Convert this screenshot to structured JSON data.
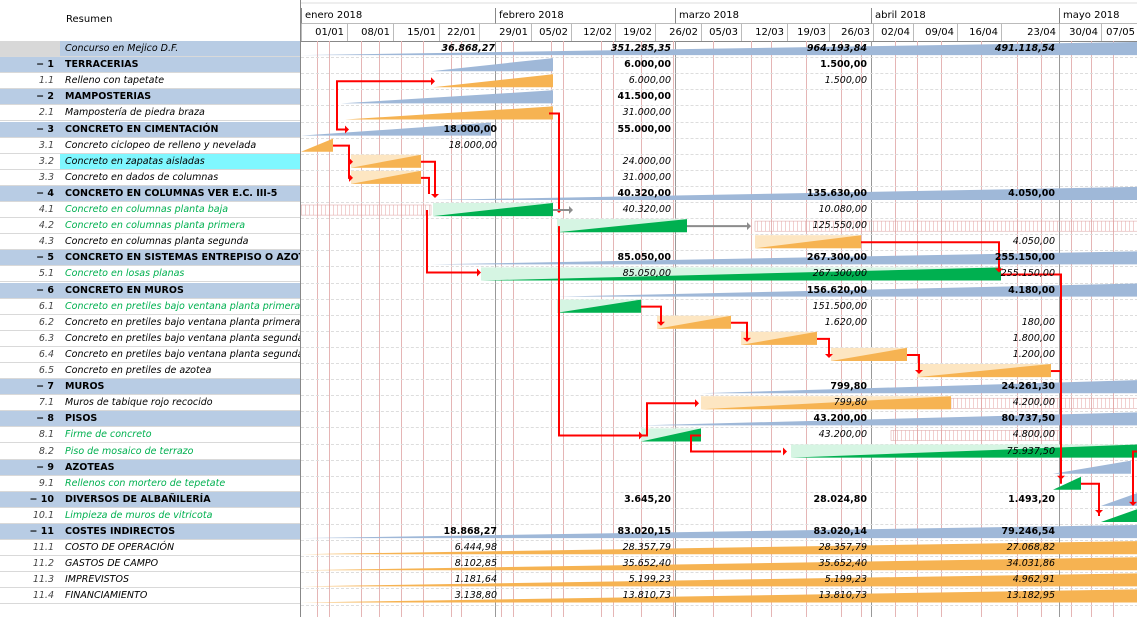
{
  "colors": {
    "summary_bar": "#9fb8d8",
    "task_bar": "#f6b352",
    "task_bar_light": "#fde6c2",
    "green_bar": "#00b050",
    "green_light": "#d6f5e3",
    "link": "#ff0000",
    "gray_link": "#8c8c8c",
    "hatch": "#e6a2a2"
  },
  "header": {
    "column_title": "Resumen"
  },
  "timeline": {
    "months": [
      "enero 2018",
      "febrero 2018",
      "marzo 2018",
      "abril 2018",
      "mayo 2018"
    ],
    "weeks": [
      "01/01",
      "08/01",
      "15/01",
      "22/01",
      "29/01",
      "05/02",
      "12/02",
      "19/02",
      "26/02",
      "05/03",
      "12/03",
      "19/03",
      "26/03",
      "02/04",
      "09/04",
      "16/04",
      "23/04",
      "30/04",
      "07/05"
    ]
  },
  "rows": [
    {
      "num": "",
      "name": "Concurso en Mejico D.F.",
      "kind": "top",
      "labels": [
        "36.868,27",
        "351.285,35",
        "964.193,84",
        "491.118,54"
      ]
    },
    {
      "num": "− 1",
      "name": "TERRACERIAS",
      "kind": "summary",
      "labels": [
        "6.000,00",
        "1.500,00"
      ]
    },
    {
      "num": "1.1",
      "name": "Relleno con tapetate",
      "kind": "task",
      "labels": [
        "6.000,00",
        "1.500,00"
      ]
    },
    {
      "num": "− 2",
      "name": "MAMPOSTERIAS",
      "kind": "summary",
      "labels": [
        "41.500,00"
      ]
    },
    {
      "num": "2.1",
      "name": "Mampostería de piedra braza",
      "kind": "task",
      "labels": [
        "31.000,00"
      ]
    },
    {
      "num": "− 3",
      "name": "CONCRETO EN CIMENTACIÓN",
      "kind": "summary",
      "labels": [
        "18.000,00",
        "55.000,00"
      ]
    },
    {
      "num": "3.1",
      "name": "Concreto ciclopeo de relleno y nevelada",
      "kind": "task",
      "labels": [
        "18.000,00"
      ]
    },
    {
      "num": "3.2",
      "name": "Concreto en zapatas aisladas",
      "kind": "task sel",
      "labels": [
        "24.000,00"
      ]
    },
    {
      "num": "3.3",
      "name": "Concreto en dados de columnas",
      "kind": "task",
      "labels": [
        "31.000,00"
      ]
    },
    {
      "num": "− 4",
      "name": "CONCRETO EN COLUMNAS VER E.C. III-5",
      "kind": "summary",
      "labels": [
        "40.320,00",
        "135.630,00",
        "4.050,00"
      ]
    },
    {
      "num": "4.1",
      "name": "Concreto en columnas planta baja",
      "kind": "task green",
      "labels": [
        "40.320,00",
        "10.080,00"
      ]
    },
    {
      "num": "4.2",
      "name": "Concreto en columnas planta primera",
      "kind": "task green",
      "labels": [
        "125.550,00"
      ]
    },
    {
      "num": "4.3",
      "name": "Concreto en columnas planta segunda",
      "kind": "task",
      "labels": [
        "4.050,00"
      ]
    },
    {
      "num": "− 5",
      "name": "CONCRETO EN SISTEMAS ENTREPISO O AZOTE",
      "kind": "summary",
      "labels": [
        "85.050,00",
        "267.300,00",
        "255.150,00"
      ]
    },
    {
      "num": "5.1",
      "name": "Concreto en losas planas",
      "kind": "task green",
      "labels": [
        "85.050,00",
        "267.300,00",
        "255.150,00"
      ]
    },
    {
      "num": "− 6",
      "name": "CONCRETO EN MUROS",
      "kind": "summary",
      "labels": [
        "156.620,00",
        "4.180,00"
      ]
    },
    {
      "num": "6.1",
      "name": "Concreto en pretiles bajo ventana planta primera",
      "kind": "task green",
      "labels": [
        "151.500,00"
      ]
    },
    {
      "num": "6.2",
      "name": "Concreto en pretiles bajo ventana planta primera",
      "kind": "task",
      "labels": [
        "1.620,00",
        "180,00"
      ]
    },
    {
      "num": "6.3",
      "name": "Concreto en pretiles bajo ventana planta segunda",
      "kind": "task",
      "labels": [
        "1.800,00"
      ]
    },
    {
      "num": "6.4",
      "name": "Concreto en pretiles bajo ventana planta segunda",
      "kind": "task",
      "labels": [
        "1.200,00"
      ]
    },
    {
      "num": "6.5",
      "name": "Concreto en pretiles de azotea",
      "kind": "task",
      "labels": []
    },
    {
      "num": "− 7",
      "name": "MUROS",
      "kind": "summary",
      "labels": [
        "799,80",
        "24.261,30"
      ]
    },
    {
      "num": "7.1",
      "name": "Muros de tabique rojo recocido",
      "kind": "task",
      "labels": [
        "799,80",
        "4.200,00"
      ]
    },
    {
      "num": "− 8",
      "name": "PISOS",
      "kind": "summary",
      "labels": [
        "43.200,00",
        "80.737,50"
      ]
    },
    {
      "num": "8.1",
      "name": "Firme de concreto",
      "kind": "task green",
      "labels": [
        "43.200,00",
        "4.800,00"
      ]
    },
    {
      "num": "8.2",
      "name": "Piso de mosaico de terrazo",
      "kind": "task green",
      "labels": [
        "75.937,50"
      ]
    },
    {
      "num": "− 9",
      "name": "AZOTEAS",
      "kind": "summary",
      "labels": []
    },
    {
      "num": "9.1",
      "name": "Rellenos con mortero de tepetate",
      "kind": "task green",
      "labels": []
    },
    {
      "num": "− 10",
      "name": "DIVERSOS DE ALBAÑILERÍA",
      "kind": "summary",
      "labels": [
        "3.645,20",
        "28.024,80",
        "1.493,20"
      ]
    },
    {
      "num": "10.1",
      "name": "Limpieza de muros de vitricota",
      "kind": "task green",
      "labels": []
    },
    {
      "num": "− 11",
      "name": "COSTES INDIRECTOS",
      "kind": "summary",
      "labels": [
        "18.868,27",
        "83.020,15",
        "83.020,14",
        "79.246,54"
      ]
    },
    {
      "num": "11.1",
      "name": "COSTO DE OPERACIÓN",
      "kind": "task",
      "labels": [
        "6.444,98",
        "28.357,79",
        "28.357,79",
        "27.068,82"
      ]
    },
    {
      "num": "11.2",
      "name": "GASTOS DE CAMPO",
      "kind": "task",
      "labels": [
        "8.102,85",
        "35.652,40",
        "35.652,40",
        "34.031,86"
      ]
    },
    {
      "num": "11.3",
      "name": "IMPREVISTOS",
      "kind": "task",
      "labels": [
        "1.181,64",
        "5.199,23",
        "5.199,23",
        "4.962,91"
      ]
    },
    {
      "num": "11.4",
      "name": "FINANCIAMIENTO",
      "kind": "task",
      "labels": [
        "3.138,80",
        "13.810,73",
        "13.810,73",
        "13.182,95"
      ]
    }
  ]
}
